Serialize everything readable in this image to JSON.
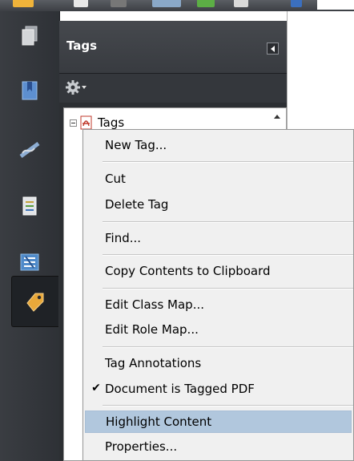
{
  "panel": {
    "title": "Tags",
    "collapse_icon": "triangle-left-icon",
    "options_icon": "gear-icon"
  },
  "tree": {
    "root_label": "Tags",
    "root_icon": "pdf-tag-icon",
    "expander_state": "expanded"
  },
  "left_rail": {
    "items": [
      {
        "icon": "pages-icon",
        "active": false
      },
      {
        "icon": "bookmarks-icon",
        "active": false
      },
      {
        "icon": "signatures-icon",
        "active": false
      },
      {
        "icon": "content-icon",
        "active": false
      },
      {
        "icon": "order-icon",
        "active": false
      },
      {
        "icon": "tags-icon",
        "active": true
      }
    ]
  },
  "context_menu": {
    "new_tag": "New Tag...",
    "cut": "Cut",
    "delete_tag": "Delete Tag",
    "find": "Find...",
    "copy_contents": "Copy Contents to Clipboard",
    "edit_class_map": "Edit Class Map...",
    "edit_role_map": "Edit Role Map...",
    "tag_annotations": "Tag Annotations",
    "document_is_tagged": "Document is Tagged PDF",
    "document_is_tagged_checked": true,
    "highlight_content": "Highlight Content",
    "highlight_content_hovered": true,
    "properties": "Properties..."
  },
  "colors": {
    "panel_bg": "#2c2f33",
    "menu_bg": "#f0f0f0",
    "menu_highlight": "#b1c7dd"
  }
}
